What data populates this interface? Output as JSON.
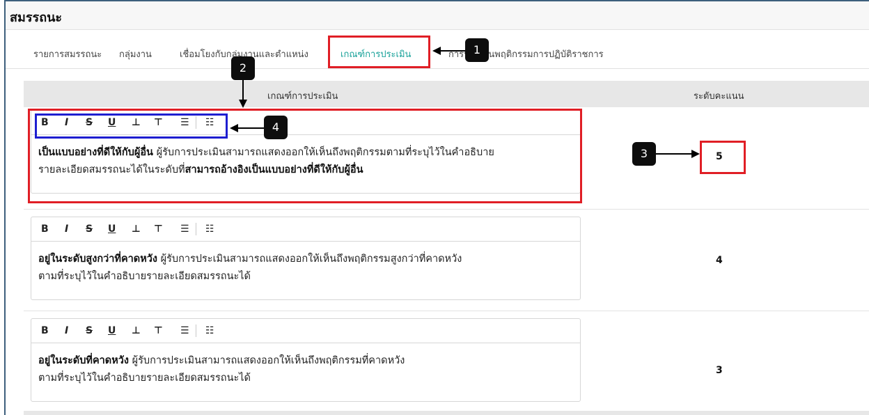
{
  "page": {
    "title": "สมรรถนะ"
  },
  "tabs": [
    {
      "label": "รายการสมรรถนะ"
    },
    {
      "label": "กลุ่มงาน"
    },
    {
      "label": "เชื่อมโยงกับกลุ่มงานและตำแหน่ง"
    },
    {
      "label": "เกณฑ์การประเมิน"
    },
    {
      "label": "การประเมินพฤติกรรมการปฏิบัติราชการ"
    }
  ],
  "table": {
    "col_criteria": "เกณฑ์การประเมิน",
    "col_score": "ระดับคะแนน"
  },
  "toolbar": {
    "bold": "B",
    "italic": "I",
    "strike": "S",
    "underline": "U",
    "subscript": "⊥",
    "superscript": "⊤",
    "bullet_list": "☰",
    "ordered_list": "☷"
  },
  "rows": [
    {
      "title": "เป็นแบบอย่างที่ดีให้กับผู้อื่น",
      "line1": "ผู้รับการประเมินสามารถแสดงออกให้เห็นถึงพฤติกรรมตามที่ระบุไว้ในคำอธิบาย",
      "line2": "รายละเอียดสมรรถนะได้ในระดับที่",
      "line2_bold": "สามารถอ้างอิงเป็นแบบอย่างที่ดีให้กับผู้อื่น",
      "score": "5"
    },
    {
      "title": "อยู่ในระดับสูงกว่าที่คาดหวัง",
      "line1": "ผู้รับการประเมินสามารถแสดงออกให้เห็นถึงพฤติกรรมสูงกว่าที่คาดหวัง",
      "line2": "ตามที่ระบุไว้ในคำอธิบายรายละเอียดสมรรถนะได้",
      "line2_bold": "",
      "score": "4"
    },
    {
      "title": "อยู่ในระดับที่คาดหวัง",
      "line1": "ผู้รับการประเมินสามารถแสดงออกให้เห็นถึงพฤติกรรมที่คาดหวัง",
      "line2": "ตามที่ระบุไว้ในคำอธิบายรายละเอียดสมรรถนะได้",
      "line2_bold": "",
      "score": "3"
    }
  ],
  "callouts": {
    "c1": "1",
    "c2": "2",
    "c3": "3",
    "c4": "4"
  },
  "colors": {
    "accent": "#1aa29a",
    "highlight_red": "#e01e25",
    "highlight_blue": "#1e1ed0"
  }
}
